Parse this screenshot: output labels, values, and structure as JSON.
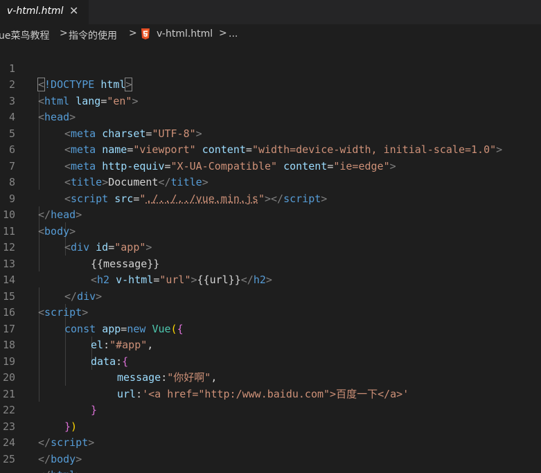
{
  "tab": {
    "title": "v-html.html",
    "close_glyph": "✕"
  },
  "breadcrumb": {
    "items": [
      "ue菜鸟教程",
      "指令的使用",
      "v-html.html",
      "..."
    ],
    "separator": ">",
    "file_icon": "html5-icon"
  },
  "editor": {
    "line_numbers": [
      "1",
      "2",
      "3",
      "4",
      "5",
      "6",
      "7",
      "8",
      "9",
      "10",
      "11",
      "12",
      "13",
      "14",
      "15",
      "16",
      "17",
      "18",
      "19",
      "20",
      "21",
      "22",
      "23",
      "24",
      "25"
    ],
    "tokens": {
      "l1": [
        "<",
        "!DOCTYPE",
        " ",
        "html",
        ">"
      ],
      "l2": [
        "<",
        "html",
        " ",
        "lang",
        "=",
        "\"en\"",
        ">"
      ],
      "l3": [
        "<",
        "head",
        ">"
      ],
      "l4": [
        "<",
        "meta",
        " ",
        "charset",
        "=",
        "\"UTF-8\"",
        ">"
      ],
      "l5": [
        "<",
        "meta",
        " ",
        "name",
        "=",
        "\"viewport\"",
        " ",
        "content",
        "=",
        "\"width=device-width, initial-scale=1.0\"",
        ">"
      ],
      "l6": [
        "<",
        "meta",
        " ",
        "http-equiv",
        "=",
        "\"X-UA-Compatible\"",
        " ",
        "content",
        "=",
        "\"ie=edge\"",
        ">"
      ],
      "l7": [
        "<",
        "title",
        ">",
        "Document",
        "</",
        "title",
        ">"
      ],
      "l8": [
        "<",
        "script",
        " ",
        "src",
        "=",
        "\"",
        "./../../vue.min.js",
        "\"",
        "></",
        "script",
        ">"
      ],
      "l9": [
        "</",
        "head",
        ">"
      ],
      "l10": [
        "<",
        "body",
        ">"
      ],
      "l11": [
        "<",
        "div",
        " ",
        "id",
        "=",
        "\"app\"",
        ">"
      ],
      "l12": [
        "{{message}}"
      ],
      "l13": [
        "<",
        "h2",
        " ",
        "v-html",
        "=",
        "\"url\"",
        ">",
        "{{url}}",
        "</",
        "h2",
        ">"
      ],
      "l14": [
        "</",
        "div",
        ">"
      ],
      "l15": [
        "<",
        "script",
        ">"
      ],
      "l16": [
        "const",
        " ",
        "app",
        "=",
        "new",
        " ",
        "Vue",
        "(",
        "{"
      ],
      "l17": [
        "el",
        ":",
        "\"#app\"",
        ","
      ],
      "l18": [
        "data",
        ":",
        "{"
      ],
      "l19": [
        "message",
        ":",
        "\"你好啊\"",
        ","
      ],
      "l20": [
        "url",
        ":",
        "'<a href=\"http:/www.baidu.com\">百度一下</a>'"
      ],
      "l21": [
        "}"
      ],
      "l22": [
        "}",
        ")"
      ],
      "l23": [
        "</",
        "script",
        ">"
      ],
      "l24": [
        "</",
        "body",
        ">"
      ],
      "l25": [
        "</",
        "html",
        ">"
      ]
    }
  },
  "colors": {
    "background": "#1e1e1e",
    "tag": "#569cd6",
    "attribute": "#9cdcfe",
    "string": "#ce9178",
    "bracket": "#808080",
    "class_name": "#4ec9b0",
    "paren_outer": "#da70d6",
    "paren_inner": "#ffd700"
  }
}
